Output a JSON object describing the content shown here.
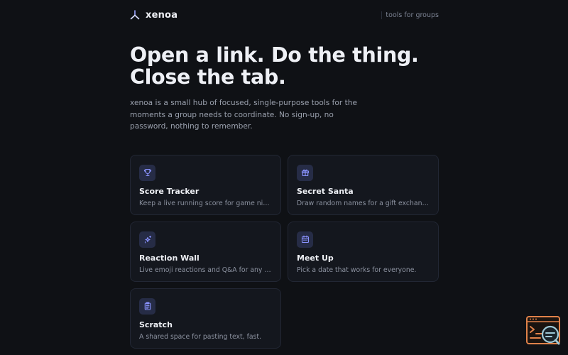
{
  "header": {
    "brand": "xenoa",
    "tagline": "tools for groups"
  },
  "hero": {
    "title": "Open a link. Do the thing.\nClose the tab.",
    "description": "xenoa is a small hub of focused, single-purpose tools for the moments a group needs to coordinate. No sign-up, no password, nothing to remember."
  },
  "tools": [
    {
      "title": "Score Tracker",
      "description": "Keep a live running score for game night.",
      "icon": "trophy-icon"
    },
    {
      "title": "Secret Santa",
      "description": "Draw random names for a gift exchange.",
      "icon": "gift-icon"
    },
    {
      "title": "Reaction Wall",
      "description": "Live emoji reactions and Q&A for any room.",
      "icon": "sparkle-icon"
    },
    {
      "title": "Meet Up",
      "description": "Pick a date that works for everyone.",
      "icon": "calendar-icon"
    },
    {
      "title": "Scratch",
      "description": "A shared space for pasting text, fast.",
      "icon": "clipboard-icon"
    }
  ],
  "colors": {
    "background": "#0f1115",
    "card": "#14171e",
    "card_border": "#222734",
    "icon_tile": "#262c46",
    "icon_accent": "#8a93ff",
    "widget_accent": "#e0824a"
  }
}
